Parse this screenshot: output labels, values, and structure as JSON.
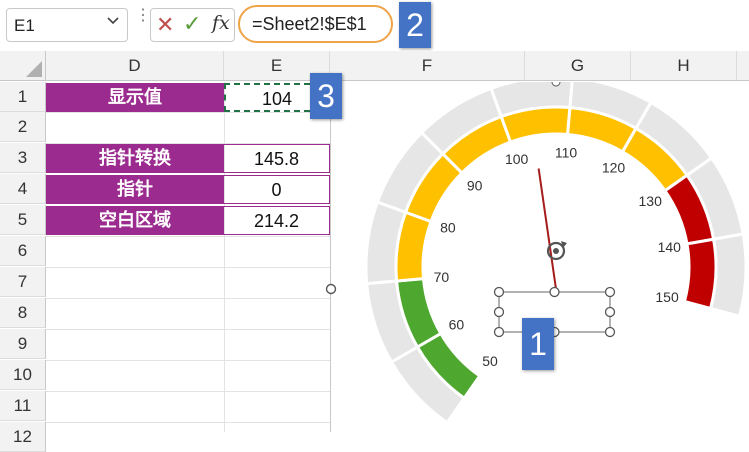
{
  "formula_bar": {
    "name_box": "E1",
    "cancel_glyph": "✕",
    "enter_glyph": "✓",
    "fx_glyph": "fx",
    "formula": "=Sheet2!$E$1"
  },
  "columns": [
    "D",
    "E",
    "F",
    "G",
    "H"
  ],
  "rows": [
    "1",
    "2",
    "3",
    "4",
    "5",
    "6",
    "7",
    "8",
    "9",
    "10",
    "11",
    "12"
  ],
  "cells": [
    {
      "row": "1",
      "label": "显示值",
      "value": "104"
    },
    {
      "row": "3",
      "label": "指针转换",
      "value": "145.8"
    },
    {
      "row": "4",
      "label": "指针",
      "value": "0"
    },
    {
      "row": "5",
      "label": "空白区域",
      "value": "214.2"
    }
  ],
  "callouts": [
    "1",
    "2",
    "3"
  ],
  "gauge": {
    "min": 50,
    "max": 150,
    "value": 104,
    "ticks": [
      50,
      60,
      70,
      80,
      90,
      100,
      110,
      120,
      130,
      140,
      150
    ],
    "bands": [
      {
        "from": 50,
        "to": 70,
        "color": "#4ea72e"
      },
      {
        "from": 70,
        "to": 130,
        "color": "#ffc000"
      },
      {
        "from": 130,
        "to": 150,
        "color": "#c00000"
      }
    ],
    "outer_color": "#e6e6e6"
  },
  "colors": {
    "label_fill": "#9b2b8e",
    "callout": "#4472c4",
    "accent_oval": "#f0a448"
  },
  "icons": [
    "chevron-down-icon",
    "cancel-icon",
    "check-icon",
    "fx-icon",
    "rotate-handle-icon"
  ]
}
